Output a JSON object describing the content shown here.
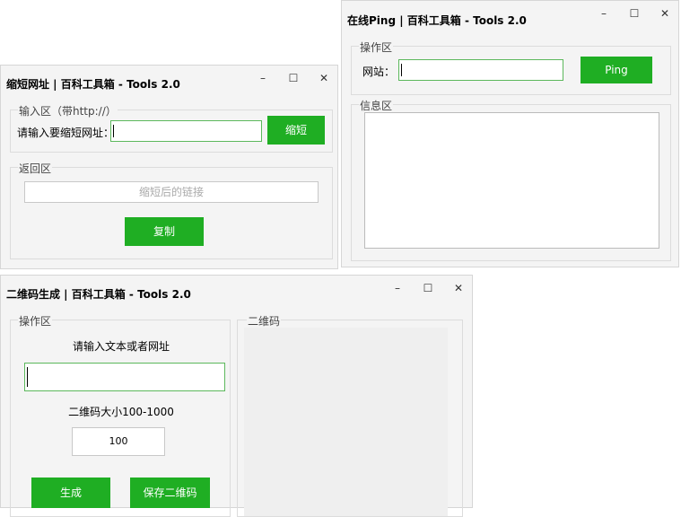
{
  "ping_window": {
    "title": "在线Ping | 百科工具箱 - Tools 2.0",
    "group_ops": "操作区",
    "site_label": "网站：",
    "site_value": "",
    "ping_button": "Ping",
    "group_info": "信息区",
    "info_text": ""
  },
  "shorten_window": {
    "title": "缩短网址 | 百科工具箱 - Tools 2.0",
    "group_input": "输入区（带http://）",
    "url_label": "请输入要缩短网址：",
    "url_value": "",
    "shorten_button": "缩短",
    "group_return": "返回区",
    "result_placeholder": "缩短后的链接",
    "copy_button": "复制"
  },
  "qr_window": {
    "title": "二维码生成 | 百科工具箱 - Tools 2.0",
    "group_ops": "操作区",
    "text_label": "请输入文本或者网址",
    "text_value": "",
    "size_label": "二维码大小100-1000",
    "size_value": "100",
    "generate_button": "生成",
    "save_button": "保存二维码",
    "group_qr": "二维码"
  },
  "window_controls": {
    "minimize": "–",
    "maximize": "☐",
    "close": "✕"
  },
  "colors": {
    "accent": "#1fae23",
    "input_border": "#5cb85c",
    "window_bg": "#f4f4f4"
  }
}
